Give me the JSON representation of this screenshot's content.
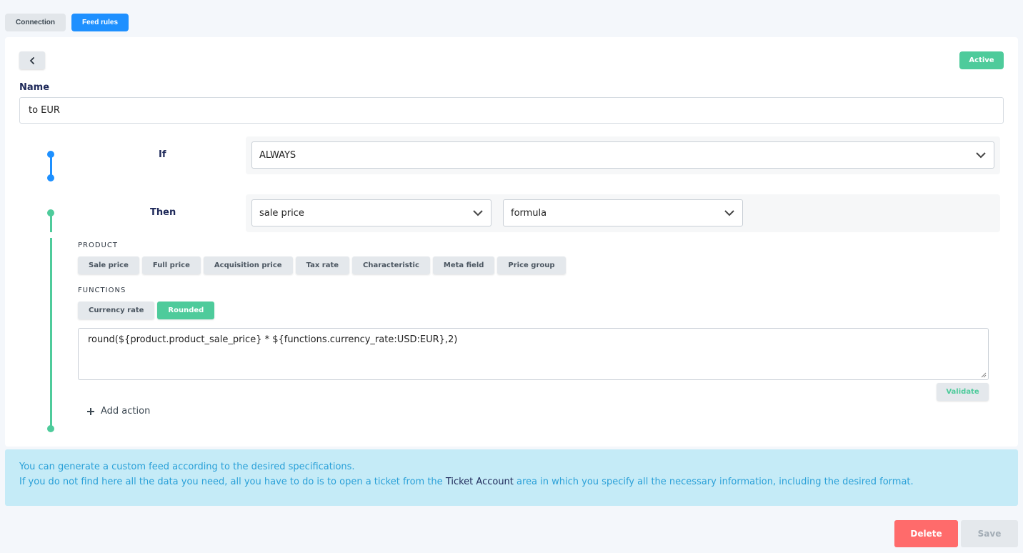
{
  "tabs": [
    {
      "label": "Connection",
      "active": false
    },
    {
      "label": "Feed rules",
      "active": true
    }
  ],
  "header": {
    "status_badge": "Active"
  },
  "name_field": {
    "label": "Name",
    "value": "to EUR"
  },
  "rule": {
    "if_label": "If",
    "if_select": "ALWAYS",
    "then_label": "Then",
    "then_field_select": "sale price",
    "then_type_select": "formula"
  },
  "product": {
    "title": "PRODUCT",
    "chips": [
      "Sale price",
      "Full price",
      "Acquisition price",
      "Tax rate",
      "Characteristic",
      "Meta field",
      "Price group"
    ]
  },
  "functions": {
    "title": "FUNCTIONS",
    "chips": [
      "Currency rate",
      "Rounded"
    ]
  },
  "formula": {
    "value": "round(${product.product_sale_price} * ${functions.currency_rate:USD:EUR},2)"
  },
  "validate_label": "Validate",
  "add_action_label": "Add action",
  "info": {
    "line1": "You can generate a custom feed according to the desired specifications.",
    "line2_pre": "If you do not find here all the data you need, all you have to do is to open a ticket from the ",
    "line2_link": "Ticket Account",
    "line2_post": " area in which you specify all the necessary information, including the desired format."
  },
  "footer": {
    "delete_label": "Delete",
    "save_label": "Save"
  },
  "colors": {
    "primary": "#1e90ff",
    "success": "#4ecb9b",
    "danger": "#ff6b6b",
    "info_bg": "#c5ebf7",
    "info_text": "#2aa0d8"
  },
  "icons": [
    "chevron-left-icon",
    "chevron-down-icon",
    "plus-icon"
  ]
}
